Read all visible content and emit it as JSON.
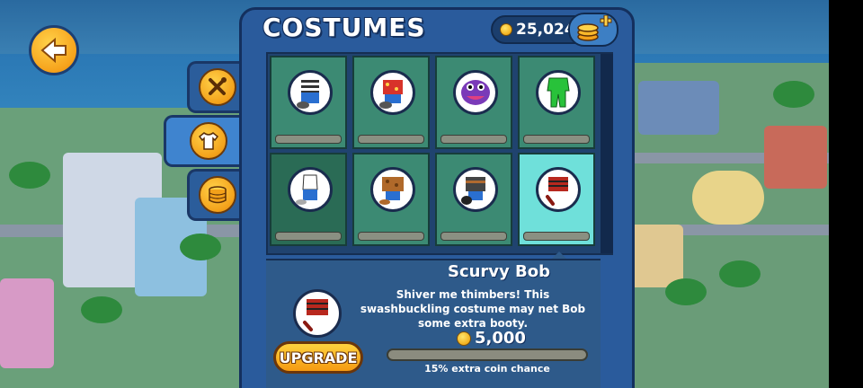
{
  "header": {
    "title": "COSTUMES",
    "coins": "25,024"
  },
  "tabs": [
    {
      "name": "tools",
      "icon": "wrench-hammer-icon",
      "active": false
    },
    {
      "name": "costumes",
      "icon": "shirt-icon",
      "active": true
    },
    {
      "name": "coins",
      "icon": "coin-stack-icon",
      "active": false
    }
  ],
  "costumes": [
    {
      "icon": "striped-shirt-costume-icon"
    },
    {
      "icon": "red-hawaiian-costume-icon"
    },
    {
      "icon": "purple-monster-costume-icon"
    },
    {
      "icon": "green-suit-costume-icon"
    },
    {
      "icon": "white-tank-costume-icon",
      "locked": true
    },
    {
      "icon": "brown-jacket-costume-icon"
    },
    {
      "icon": "armor-vest-costume-icon"
    },
    {
      "icon": "pirate-costume-icon",
      "selected": true
    }
  ],
  "detail": {
    "name": "Scurvy Bob",
    "description": "Shiver me thimbers! This swashbuckling costume may net Bob some extra booty.",
    "upgrade_label": "UPGRADE",
    "price": "5,000",
    "bonus": "15% extra coin chance",
    "progress": 0.0
  },
  "colors": {
    "panel": "#2a5b9c",
    "card": "#3c8a73",
    "card_selected": "#6fe0da",
    "gold": "#f6a21b"
  }
}
